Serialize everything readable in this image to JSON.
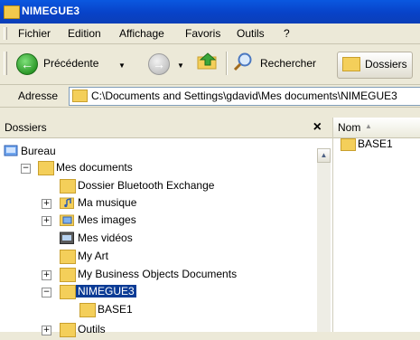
{
  "window": {
    "title": "NIMEGUE3"
  },
  "menu": {
    "items": [
      "Fichier",
      "Edition",
      "Affichage",
      "Favoris",
      "Outils",
      "?"
    ]
  },
  "toolbar": {
    "back_label": "Précédente",
    "search_label": "Rechercher",
    "folders_label": "Dossiers"
  },
  "address": {
    "label": "Adresse",
    "value": "C:\\Documents and Settings\\gdavid\\Mes documents\\NIMEGUE3"
  },
  "folders_pane": {
    "title": "Dossiers",
    "close_glyph": "×"
  },
  "tree": {
    "bureau": "Bureau",
    "mes_documents": "Mes documents",
    "bluetooth": "Dossier Bluetooth Exchange",
    "musique": "Ma musique",
    "images": "Mes images",
    "videos": "Mes vidéos",
    "my_art": "My Art",
    "business": "My Business Objects Documents",
    "nimegue3": "NIMEGUE3",
    "base1": "BASE1",
    "outils": "Outils"
  },
  "list_pane": {
    "column_name": "Nom",
    "items": [
      "BASE1"
    ]
  },
  "colors": {
    "selection": "#0b3b95",
    "title_bar": "#0842c8",
    "chrome": "#ece9d8"
  },
  "icons": [
    "folder-icon",
    "back-arrow-icon",
    "forward-arrow-icon",
    "up-folder-icon",
    "search-icon",
    "folders-icon",
    "desktop-icon",
    "music-folder-icon",
    "pictures-folder-icon",
    "videos-folder-icon"
  ]
}
